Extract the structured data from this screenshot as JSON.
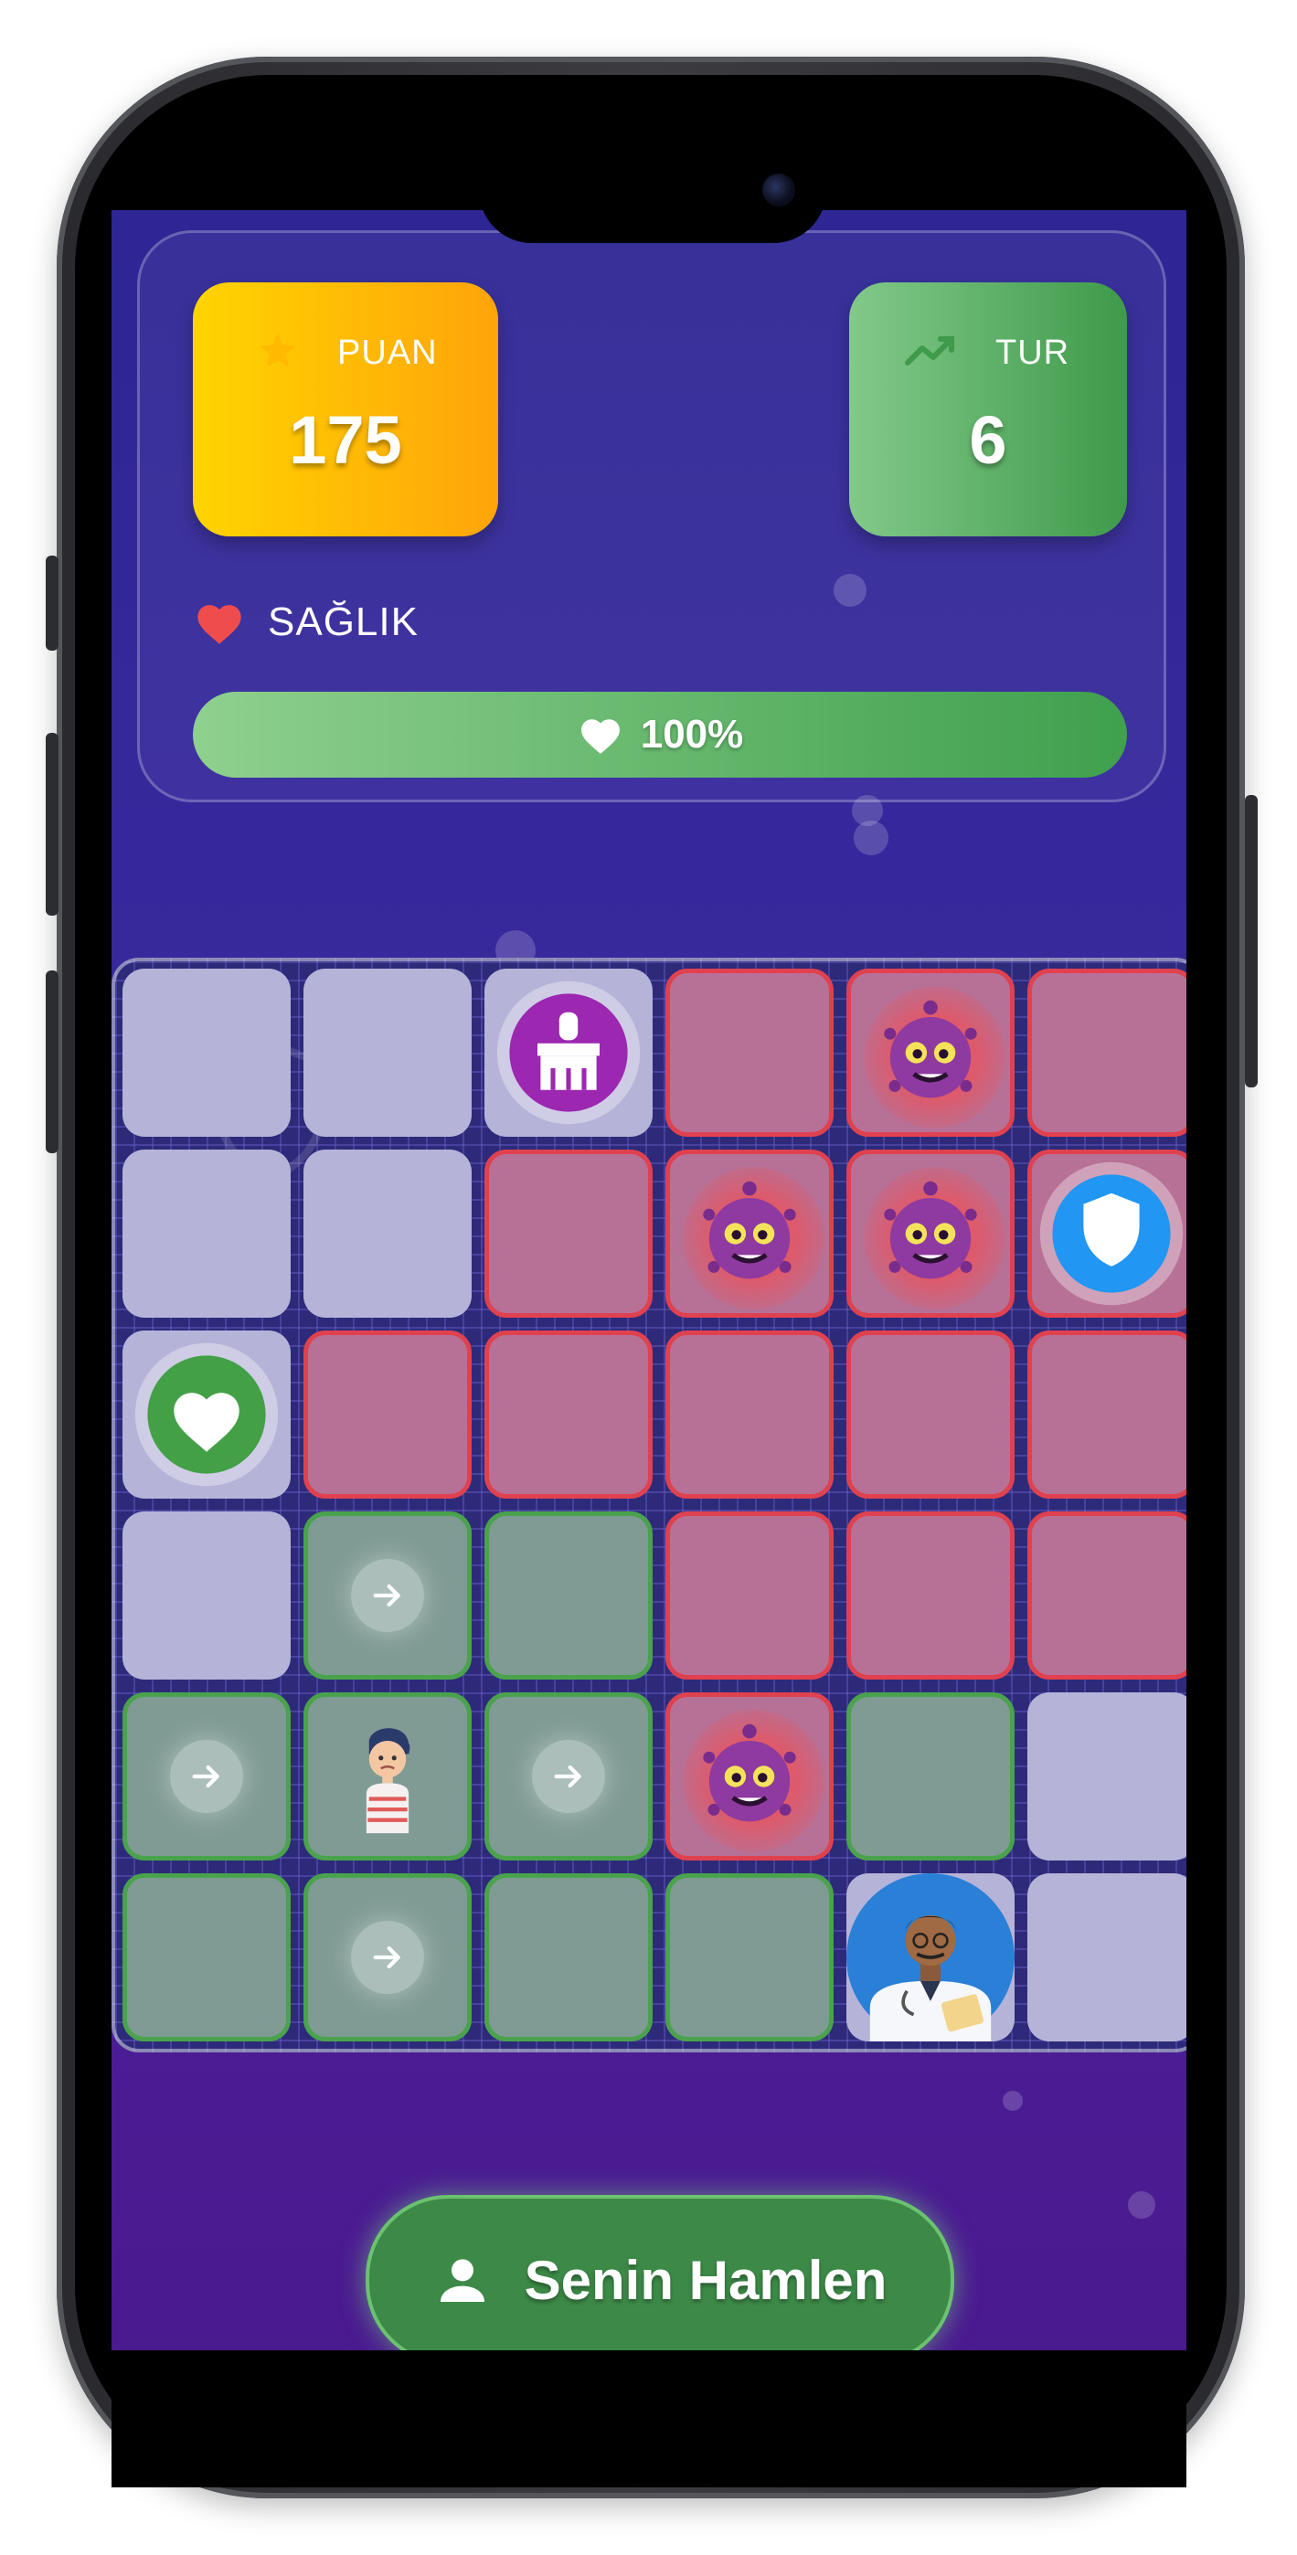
{
  "stats": {
    "score_label": "PUAN",
    "score_value": "175",
    "turn_label": "TUR",
    "turn_value": "6"
  },
  "health": {
    "label": "SAĞLIK",
    "percent_text": "100%",
    "percent": 100
  },
  "board": {
    "rows": 6,
    "cols": 6,
    "cells": [
      [
        "gray",
        "gray",
        "gray",
        "red",
        "red",
        "red"
      ],
      [
        "gray",
        "gray",
        "red",
        "red",
        "red",
        "red"
      ],
      [
        "gray",
        "red",
        "red",
        "red",
        "red",
        "red"
      ],
      [
        "gray",
        "green",
        "green",
        "red",
        "red",
        "red"
      ],
      [
        "green",
        "green",
        "green",
        "red",
        "green",
        "gray"
      ],
      [
        "green",
        "green",
        "green",
        "green",
        "gray",
        "gray"
      ]
    ],
    "pieces": [
      {
        "row": 0,
        "col": 2,
        "type": "cleaner-powerup"
      },
      {
        "row": 0,
        "col": 4,
        "type": "virus"
      },
      {
        "row": 1,
        "col": 3,
        "type": "virus"
      },
      {
        "row": 1,
        "col": 4,
        "type": "virus"
      },
      {
        "row": 1,
        "col": 5,
        "type": "shield-powerup"
      },
      {
        "row": 2,
        "col": 0,
        "type": "heart-powerup"
      },
      {
        "row": 3,
        "col": 1,
        "type": "move-arrow"
      },
      {
        "row": 4,
        "col": 0,
        "type": "move-arrow"
      },
      {
        "row": 4,
        "col": 1,
        "type": "patient"
      },
      {
        "row": 4,
        "col": 2,
        "type": "move-arrow"
      },
      {
        "row": 4,
        "col": 3,
        "type": "virus"
      },
      {
        "row": 5,
        "col": 1,
        "type": "move-arrow"
      },
      {
        "row": 5,
        "col": 4,
        "type": "doctor"
      }
    ]
  },
  "turn_button": {
    "label": "Senin Hamlen",
    "icon": "person-icon"
  },
  "colors": {
    "score_card": "#ffc107",
    "turn_card": "#4caf50",
    "cell_red_border": "#e0414f",
    "cell_green_border": "#4aa34c",
    "health_bar": "#4caf50"
  }
}
